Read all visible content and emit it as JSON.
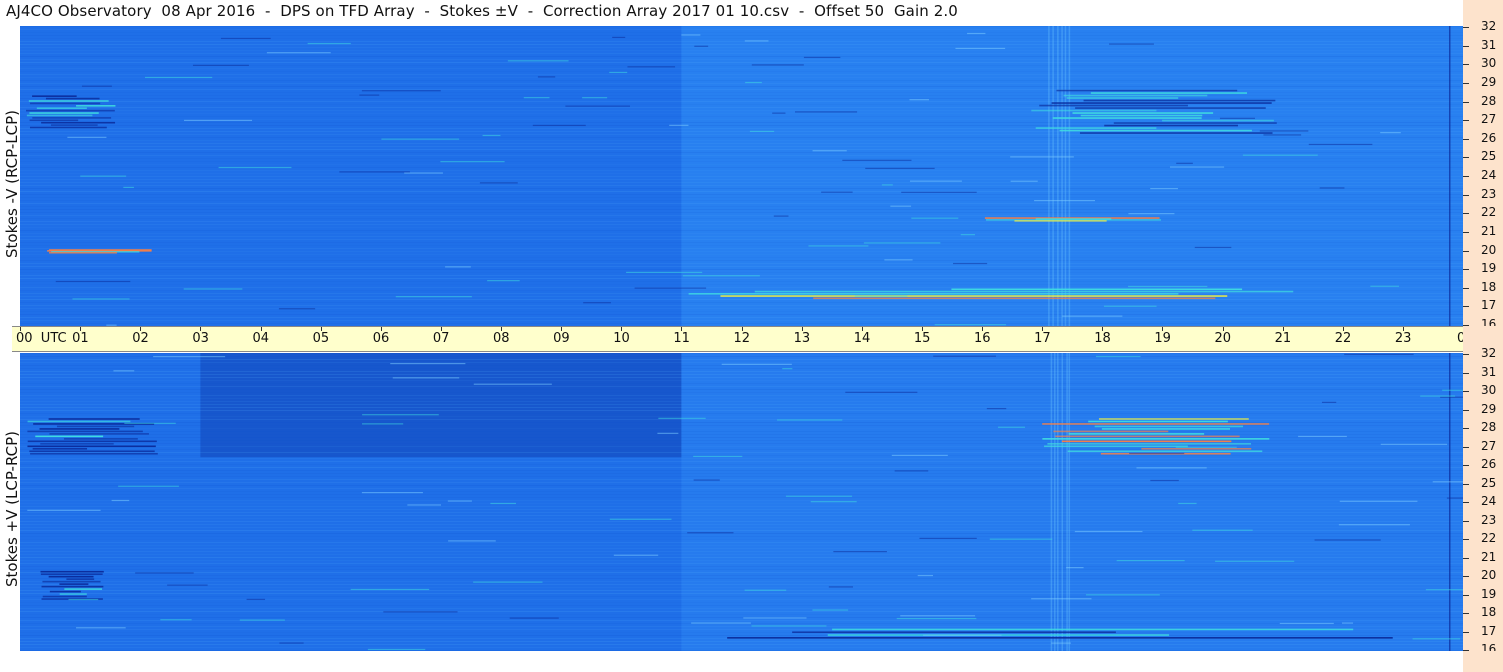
{
  "title": "AJ4CO Observatory  08 Apr 2016  -  DPS on TFD Array  -  Stokes ±V  -  Correction Array 2017 01 10.csv  -  Offset 50  Gain 2.0",
  "panels": {
    "top_label": "Stokes -V (RCP-LCP)",
    "bottom_label": "Stokes +V (LCP-RCP)"
  },
  "colors": {
    "background_blue": "#1f6fe8",
    "light_blue": "#3aa0ff",
    "dark_blue": "#0a2a9a",
    "cyan": "#40e0e0",
    "yellow": "#f0f040",
    "time_axis_bg": "#ffffcc",
    "freq_axis_bg": "#fde3cc"
  },
  "chart_data": {
    "type": "heatmap",
    "x_axis": {
      "unit": "UTC",
      "range": [
        0,
        24
      ],
      "tick_labels": [
        "00",
        "01",
        "02",
        "03",
        "04",
        "05",
        "06",
        "07",
        "08",
        "09",
        "10",
        "11",
        "12",
        "13",
        "14",
        "15",
        "16",
        "17",
        "18",
        "19",
        "20",
        "21",
        "22",
        "23",
        "00"
      ]
    },
    "y_axis": {
      "unit": "MHz",
      "range": [
        16,
        32
      ],
      "tick_labels": [
        "32",
        "31",
        "30",
        "29",
        "28",
        "27",
        "26",
        "25",
        "24",
        "23",
        "22",
        "21",
        "20",
        "19",
        "18",
        "17",
        "16"
      ]
    },
    "panels": [
      {
        "name": "Stokes -V (RCP-LCP)",
        "features": [
          {
            "utc": [
              0.1,
              1.6
            ],
            "mhz": [
              26.5,
              28.3
            ],
            "kind": "dark"
          },
          {
            "utc": [
              16.8,
              21.0
            ],
            "mhz": [
              26.2,
              28.6
            ],
            "kind": "dark"
          },
          {
            "utc": [
              11.0,
              21.4
            ],
            "mhz": [
              17.4,
              18.0
            ],
            "kind": "bright"
          },
          {
            "utc": [
              15.9,
              19.0
            ],
            "mhz": [
              21.6,
              21.8
            ],
            "kind": "bright"
          },
          {
            "utc": [
              0.3,
              2.2
            ],
            "mhz": [
              19.9,
              20.1
            ],
            "kind": "bright"
          }
        ]
      },
      {
        "name": "Stokes +V (LCP-RCP)",
        "features": [
          {
            "utc": [
              0.1,
              2.3
            ],
            "mhz": [
              26.5,
              28.5
            ],
            "kind": "dark"
          },
          {
            "utc": [
              17.0,
              20.8
            ],
            "mhz": [
              26.5,
              28.5
            ],
            "kind": "bright"
          },
          {
            "utc": [
              11.0,
              23.3
            ],
            "mhz": [
              16.6,
              17.2
            ],
            "kind": "dark"
          },
          {
            "utc": [
              0.3,
              1.4
            ],
            "mhz": [
              18.7,
              20.3
            ],
            "kind": "dark"
          }
        ]
      }
    ]
  }
}
